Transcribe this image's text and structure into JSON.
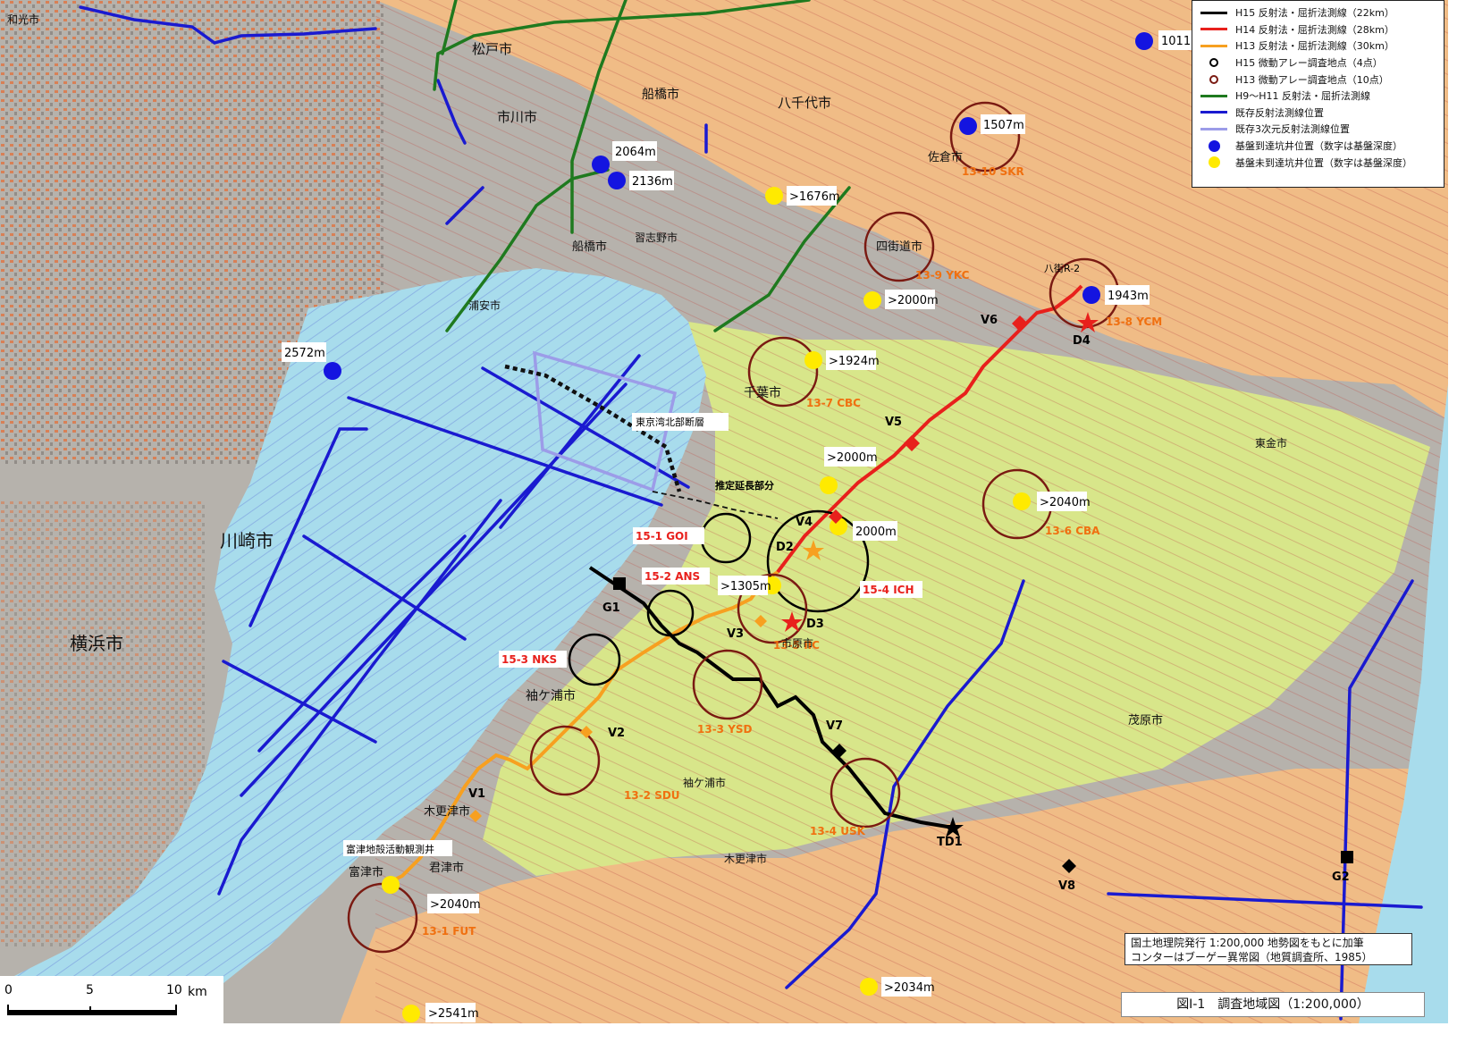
{
  "legend": {
    "items": [
      {
        "label": "H15 反射法・屈折法測線（22km）",
        "kind": "line",
        "color": "#000000"
      },
      {
        "label": "H14 反射法・屈折法測線（28km）",
        "kind": "line",
        "color": "#e8201c"
      },
      {
        "label": "H13 反射法・屈折法測線（30km）",
        "kind": "line",
        "color": "#f7a020"
      },
      {
        "label": "H15 微動アレー調査地点（4点）",
        "kind": "ring",
        "color": "#000000"
      },
      {
        "label": "H13 微動アレー調査地点（10点）",
        "kind": "ring",
        "color": "#7a1a12"
      },
      {
        "label": "H9～H11 反射法・屈折法測線",
        "kind": "line",
        "color": "#1f7a1f"
      },
      {
        "label": "既存反射法測線位置",
        "kind": "line",
        "color": "#1a1ad0"
      },
      {
        "label": "既存3次元反射法測線位置",
        "kind": "line",
        "color": "#9c9ce8"
      },
      {
        "label": "基盤到達坑井位置（数字は基盤深度）",
        "kind": "dot",
        "color": "#1414e0"
      },
      {
        "label": "基盤未到達坑井位置（数字は基盤深度）",
        "kind": "dot",
        "color": "#ffea00"
      }
    ]
  },
  "note": {
    "line1": "国土地理院発行 1:200,000 地勢図をもとに加筆",
    "line2": "コンターはブーゲー異常図（地質調査所、1985）"
  },
  "figure_title": "図Ⅰ-1　調査地域図（1:200,000）",
  "scale": {
    "zero": "0",
    "mid": "5",
    "end": "10",
    "unit": "km"
  },
  "wells": {
    "reached": [
      "1011m",
      "1507m",
      "2064m",
      "2136m",
      "1943m",
      "2572m"
    ],
    "not_reached": [
      ">1676m",
      ">2000m",
      ">1924m",
      ">2000m",
      ">2040m",
      "2000m",
      ">1305m",
      ">2040m",
      ">2034m",
      ">2541m"
    ]
  },
  "h15_sites": [
    "15-1 GOI",
    "15-2 ANS",
    "15-3 NKS",
    "15-4 ICH"
  ],
  "h13_sites": [
    "13-1 FUT",
    "13-2 SDU",
    "13-3 YSD",
    "13-4 USK",
    "13-5 IIC",
    "13-6 CBA",
    "13-7 CBC",
    "13-8 YCM",
    "13-9 YKC",
    "13-10 SKR"
  ],
  "stations": [
    "V1",
    "V2",
    "V3",
    "V4",
    "V5",
    "V6",
    "V7",
    "V8",
    "D2",
    "D3",
    "D4",
    "G1",
    "G2",
    "TD1"
  ],
  "annotations": {
    "fault": "東京湾北部断層",
    "extension": "推定延長部分",
    "futtsu_well": "富津地殻活動観測井",
    "yachimata": "八街R-2"
  },
  "place_names": {
    "ichikawa": "市川市",
    "matsudo": "松戸市",
    "funabashi_n": "船橋市",
    "funabashi": "船橋市",
    "yachiyo": "八千代市",
    "sakura": "佐倉市",
    "yotsukaido": "四街道市",
    "chiba": "千葉市",
    "urayasu": "浦安市",
    "kawasaki": "川崎市",
    "yokohama": "横浜市",
    "sodegaura": "袖ケ浦市",
    "sodegaura2": "袖ケ浦市",
    "kisarazu": "木更津市",
    "kisarazu2": "木更津市",
    "kimitsu": "君津市",
    "futtsu": "富津市",
    "togane": "東金市",
    "mobara": "茂原市",
    "narashino": "習志野市",
    "wako": "和光市",
    "ichihara": "市原市"
  },
  "colors": {
    "sea": "#a8dcec",
    "land_yellow": "#d8e68a",
    "land_orange": "#f0bc86",
    "land_grey": "#b6b2ac",
    "urban": "#e86a30",
    "h15": "#000000",
    "h14": "#e8201c",
    "h13": "#f7a020",
    "existing": "#1a1ad0",
    "existing3d": "#9c9ce8",
    "h9": "#1f7a1f",
    "h13ring": "#7a1a12",
    "h15label": "#e8201c",
    "h13label": "#f07010"
  }
}
